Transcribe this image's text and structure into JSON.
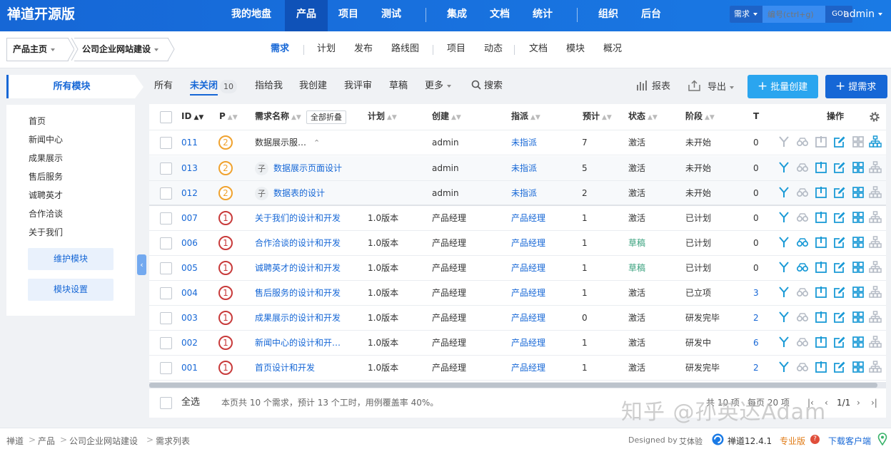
{
  "brand": "禅道开源版",
  "topnav": [
    "我的地盘",
    "产品",
    "项目",
    "测试",
    "集成",
    "文档",
    "统计",
    "组织",
    "后台"
  ],
  "search": {
    "type": "需求",
    "placeholder": "编号(ctrl+g)",
    "go": "GO!"
  },
  "user": "admin",
  "crumbs": {
    "product_home": "产品主页",
    "product_name": "公司企业网站建设"
  },
  "subnav": [
    "需求",
    "计划",
    "发布",
    "路线图",
    "项目",
    "动态",
    "文档",
    "模块",
    "概况"
  ],
  "sidebar": {
    "title": "所有模块",
    "modules": [
      "首页",
      "新闻中心",
      "成果展示",
      "售后服务",
      "诚聘英才",
      "合作洽谈",
      "关于我们"
    ],
    "maintain": "维护模块",
    "settings": "模块设置"
  },
  "tabs": {
    "all": "所有",
    "unclosed": "未关闭",
    "unclosed_count": "10",
    "assigned": "指给我",
    "created": "我创建",
    "reviewed": "我评审",
    "draft": "草稿",
    "more": "更多",
    "search": "搜索"
  },
  "tools": {
    "report": "报表",
    "export": "导出",
    "batch_create": "批量创建",
    "create": "提需求"
  },
  "columns": {
    "id": "ID",
    "p": "P",
    "name": "需求名称",
    "collapse_all": "全部折叠",
    "plan": "计划",
    "creator": "创建",
    "assignee": "指派",
    "estimate": "预计",
    "status": "状态",
    "stage": "阶段",
    "t": "T",
    "actions": "操作"
  },
  "rows": [
    {
      "id": "011",
      "pri": "2",
      "name": "数据展示服…",
      "child": false,
      "parent": true,
      "plan": "",
      "creator": "admin",
      "assignee": "未指派",
      "estimate": "7",
      "status": "激活",
      "stage": "未开始",
      "t": "0"
    },
    {
      "id": "013",
      "pri": "2",
      "name": "数据展示页面设计",
      "child": true,
      "child_tag": "子",
      "plan": "",
      "creator": "admin",
      "assignee": "未指派",
      "estimate": "5",
      "status": "激活",
      "stage": "未开始",
      "t": "0"
    },
    {
      "id": "012",
      "pri": "2",
      "name": "数据表的设计",
      "child": true,
      "child_tag": "子",
      "plan": "",
      "creator": "admin",
      "assignee": "未指派",
      "estimate": "2",
      "status": "激活",
      "stage": "未开始",
      "t": "0"
    },
    {
      "id": "007",
      "pri": "1",
      "name": "关于我们的设计和开发",
      "child": false,
      "plan": "1.0版本",
      "creator": "产品经理",
      "assignee": "产品经理",
      "estimate": "1",
      "status": "激活",
      "stage": "已计划",
      "t": "0"
    },
    {
      "id": "006",
      "pri": "1",
      "name": "合作洽谈的设计和开发",
      "child": false,
      "plan": "1.0版本",
      "creator": "产品经理",
      "assignee": "产品经理",
      "estimate": "1",
      "status": "草稿",
      "stage": "已计划",
      "t": "0"
    },
    {
      "id": "005",
      "pri": "1",
      "name": "诚聘英才的设计和开发",
      "child": false,
      "plan": "1.0版本",
      "creator": "产品经理",
      "assignee": "产品经理",
      "estimate": "1",
      "status": "草稿",
      "stage": "已计划",
      "t": "0"
    },
    {
      "id": "004",
      "pri": "1",
      "name": "售后服务的设计和开发",
      "child": false,
      "plan": "1.0版本",
      "creator": "产品经理",
      "assignee": "产品经理",
      "estimate": "1",
      "status": "激活",
      "stage": "已立项",
      "t": "3"
    },
    {
      "id": "003",
      "pri": "1",
      "name": "成果展示的设计和开发",
      "child": false,
      "plan": "1.0版本",
      "creator": "产品经理",
      "assignee": "产品经理",
      "estimate": "0",
      "status": "激活",
      "stage": "研发完毕",
      "t": "2"
    },
    {
      "id": "002",
      "pri": "1",
      "name": "新闻中心的设计和开…",
      "child": false,
      "plan": "1.0版本",
      "creator": "产品经理",
      "assignee": "产品经理",
      "estimate": "1",
      "status": "激活",
      "stage": "研发中",
      "t": "6"
    },
    {
      "id": "001",
      "pri": "1",
      "name": "首页设计和开发",
      "child": false,
      "plan": "1.0版本",
      "creator": "产品经理",
      "assignee": "产品经理",
      "estimate": "1",
      "status": "激活",
      "stage": "研发完毕",
      "t": "2"
    }
  ],
  "footer": {
    "select_all": "全选",
    "summary": "本页共 10 个需求，预计 13 个工时，用例覆盖率 40%。",
    "total": "共 10 项",
    "per_page": "每页 20 项",
    "page": "1/1"
  },
  "bottom": {
    "crumbs": [
      "禅道",
      "产品",
      "公司企业网站建设",
      "需求列表"
    ],
    "designed_by": "Designed by",
    "designer": "艾体验",
    "version": "禅道12.4.1",
    "pro": "专业版",
    "download": "下载客户端"
  },
  "watermark": "知乎 @孙英达Adam",
  "colors": {
    "primary": "#1667d6",
    "topbar": "#1a6fe0",
    "pri1": "#c83a3a",
    "pri2": "#f0a22e",
    "action": "#1a9ad6",
    "action_disabled": "#b5bcc6",
    "draft": "#3aa17e"
  }
}
